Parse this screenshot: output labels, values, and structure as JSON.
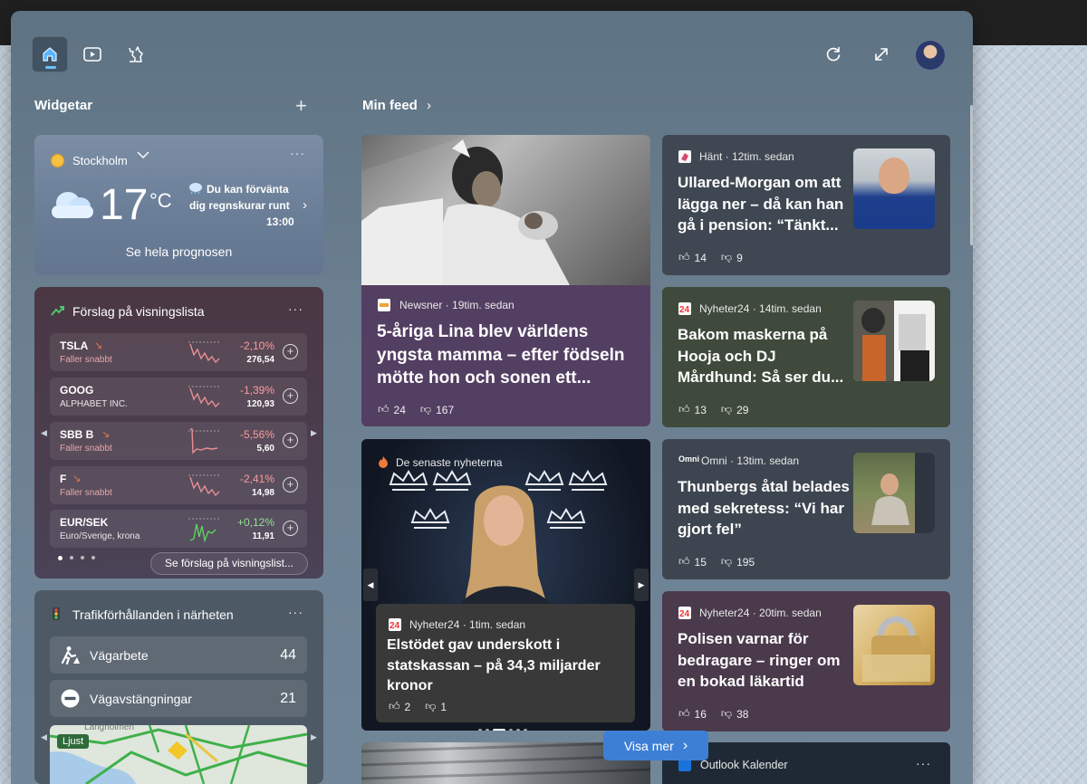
{
  "header": {
    "icons": [
      "home-icon",
      "video-icon",
      "games-icon",
      "refresh-icon",
      "expand-icon"
    ]
  },
  "widgets": {
    "title": "Widgetar",
    "weather": {
      "location": "Stockholm",
      "temp": "17",
      "unit": "°C",
      "forecast_line1": "Du kan förvänta",
      "forecast_line2": "dig regnskurar runt",
      "forecast_time": "13:00",
      "link": "Se hela prognosen"
    },
    "watchlist": {
      "title": "Förslag på visningslista",
      "stocks": [
        {
          "symbol": "TSLA",
          "sub": "Faller snabbt",
          "change": "-2,10%",
          "price": "276,54",
          "trend": "down"
        },
        {
          "symbol": "GOOG",
          "sub": "ALPHABET INC.",
          "change": "-1,39%",
          "price": "120,93",
          "trend": "down"
        },
        {
          "symbol": "SBB B",
          "sub": "Faller snabbt",
          "change": "-5,56%",
          "price": "5,60",
          "trend": "down"
        },
        {
          "symbol": "F",
          "sub": "Faller snabbt",
          "change": "-2,41%",
          "price": "14,98",
          "trend": "down"
        },
        {
          "symbol": "EUR/SEK",
          "sub": "Euro/Sverige, krona",
          "change": "+0,12%",
          "price": "11,91",
          "trend": "up"
        }
      ],
      "button": "Se förslag på visningslist..."
    },
    "traffic": {
      "title": "Trafikförhållanden i närheten",
      "rows": [
        {
          "label": "Vägarbete",
          "count": "44"
        },
        {
          "label": "Vägavstängningar",
          "count": "21"
        }
      ],
      "map_label": "Ljust",
      "map_place": "Langholmen"
    }
  },
  "feed": {
    "title": "Min feed",
    "cards": [
      {
        "source": "Hänt · 12tim. sedan",
        "headline": [
          "Ullared-Morgan om att",
          "lägga ner – då kan han",
          "gå i pension: “Tänkt..."
        ],
        "likes": "14",
        "dislikes": "9"
      },
      {
        "source": "Newsner · 19tim. sedan",
        "headline": [
          "5-åriga Lina blev världens",
          "yngsta mamma – efter födseln",
          "mötte hon och sonen ett..."
        ],
        "likes": "24",
        "dislikes": "167"
      },
      {
        "source": "Nyheter24 · 14tim. sedan",
        "headline": [
          "Bakom maskerna på",
          "Hooja och DJ",
          "Mårdhund: Så ser du..."
        ],
        "likes": "13",
        "dislikes": "29"
      },
      {
        "source": "De senaste nyheterna",
        "sub_source": "Nyheter24 · 1tim. sedan",
        "headline": [
          "Elstödet gav underskott i",
          "statskassan – på 34,3 miljarder",
          "kronor"
        ],
        "likes": "2",
        "dislikes": "1"
      },
      {
        "source": "Omni · 13tim. sedan",
        "headline": [
          "Thunbergs åtal belades",
          "med sekretess: “Vi har",
          "gjort fel”"
        ],
        "likes": "15",
        "dislikes": "195"
      },
      {
        "source": "Nyheter24 · 20tim. sedan",
        "headline": [
          "Polisen varnar för",
          "bedragare – ringer om",
          "en bokad läkartid"
        ],
        "likes": "16",
        "dislikes": "38"
      },
      {
        "source": "Outlook Kalender"
      }
    ],
    "more_button": "Visa mer"
  }
}
